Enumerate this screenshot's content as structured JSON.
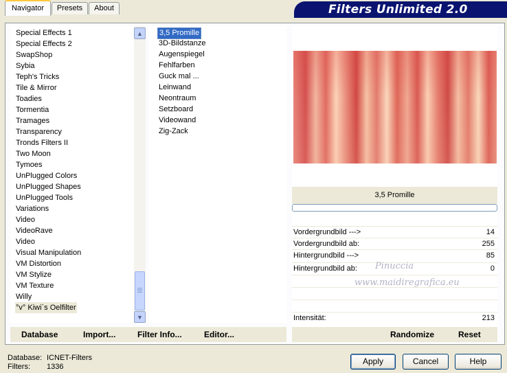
{
  "window": {
    "banner_title": "Filters Unlimited 2.0"
  },
  "tabs": [
    {
      "label": "Navigator",
      "active": true
    },
    {
      "label": "Presets",
      "active": false
    },
    {
      "label": "About",
      "active": false
    }
  ],
  "categories": {
    "items": [
      "Special Effects 1",
      "Special Effects 2",
      "SwapShop",
      "Sybia",
      "Teph's Tricks",
      "Tile & Mirror",
      "Toadies",
      "Tormentia",
      "Tramages",
      "Transparency",
      "Tronds Filters II",
      "Two Moon",
      "Tymoes",
      "UnPlugged Colors",
      "UnPlugged Shapes",
      "UnPlugged Tools",
      "Variations",
      "Video",
      "VideoRave",
      "Video",
      "Visual Manipulation",
      "VM Distortion",
      "VM Stylize",
      "VM Texture",
      "Willy",
      "°v° Kiwi`s Oelfilter"
    ],
    "selected_index": 25
  },
  "filters": {
    "items": [
      "3,5 Promille",
      "3D-Bildstanze",
      "Augenspiegel",
      "Fehlfarben",
      "Guck mal ...",
      "Leinwand",
      "Neontraum",
      "Setzboard",
      "Videowand",
      "Zig-Zack"
    ],
    "selected_index": 0
  },
  "preview": {
    "filter_name": "3,5 Promille"
  },
  "parameters": [
    {
      "label": "Vordergrundbild --->",
      "value": "14"
    },
    {
      "label": "Vordergrundbild ab:",
      "value": "255"
    },
    {
      "label": "Hintergrundbild --->",
      "value": "85"
    },
    {
      "label": "Hintergrundbild ab:",
      "value": "0"
    },
    {
      "label": "Intensität:",
      "value": "213"
    }
  ],
  "watermark": {
    "line1": "Pinuccia",
    "line2": "www.maidiregrafica.eu"
  },
  "actions": {
    "database": "Database",
    "import": "Import...",
    "filter_info": "Filter Info...",
    "editor": "Editor...",
    "randomize": "Randomize",
    "reset": "Reset"
  },
  "footer": {
    "database_label": "Database:",
    "database_value": "ICNET-Filters",
    "filters_label": "Filters:",
    "filters_value": "1336"
  },
  "buttons": {
    "apply": "Apply",
    "cancel": "Cancel",
    "help": "Help"
  }
}
